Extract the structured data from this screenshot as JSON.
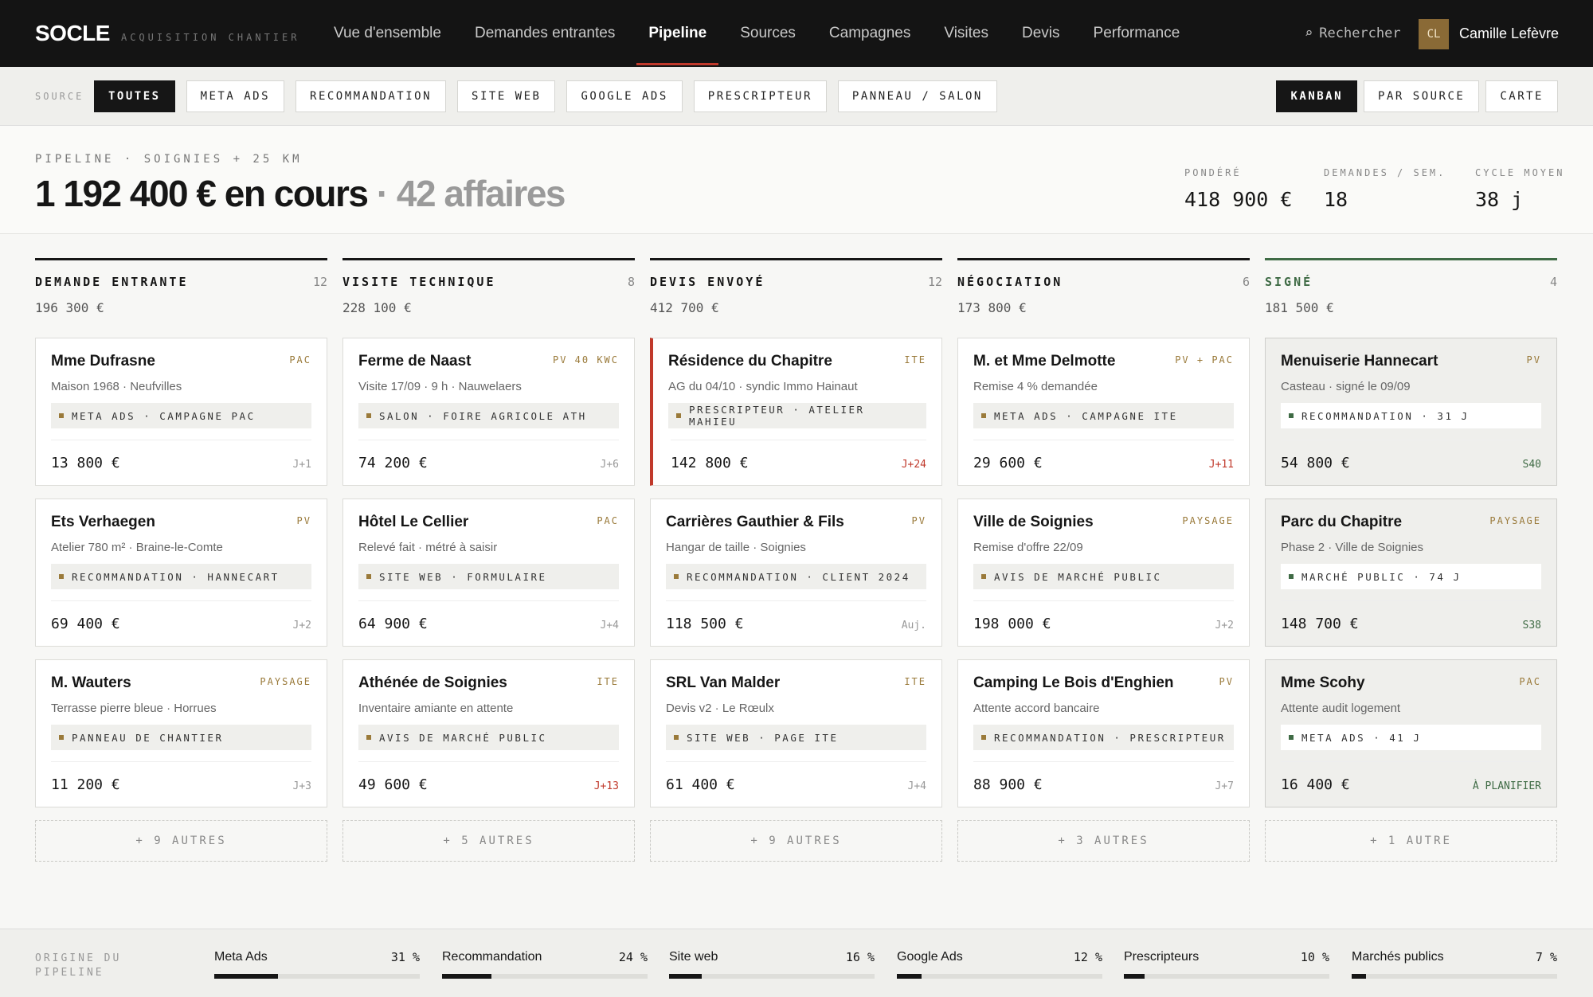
{
  "brand": {
    "name": "SOCLE",
    "subtitle": "ACQUISITION CHANTIER"
  },
  "nav": [
    {
      "label": "Vue d'ensemble"
    },
    {
      "label": "Demandes entrantes"
    },
    {
      "label": "Pipeline",
      "active": true
    },
    {
      "label": "Sources"
    },
    {
      "label": "Campagnes"
    },
    {
      "label": "Visites"
    },
    {
      "label": "Devis"
    },
    {
      "label": "Performance"
    }
  ],
  "search": {
    "label": "Rechercher",
    "icon": "search-icon"
  },
  "user": {
    "initials": "CL",
    "name": "Camille Lefèvre"
  },
  "filters": {
    "label": "SOURCE",
    "chips": [
      "TOUTES",
      "META ADS",
      "RECOMMANDATION",
      "SITE WEB",
      "GOOGLE ADS",
      "PRESCRIPTEUR",
      "PANNEAU / SALON"
    ],
    "active": "TOUTES"
  },
  "views": [
    "KANBAN",
    "PAR SOURCE",
    "CARTE"
  ],
  "summary": {
    "label": "PIPELINE · SOIGNIES + 25 KM",
    "total": "1 192 400 € en cours",
    "deals": " · 42 affaires",
    "stats": [
      {
        "label": "PONDÉRÉ",
        "value": "418 900 €"
      },
      {
        "label": "DEMANDES / SEM.",
        "value": "18"
      },
      {
        "label": "CYCLE MOYEN",
        "value": "38 j"
      }
    ]
  },
  "columns": [
    {
      "title": "DEMANDE ENTRANTE",
      "count": "12",
      "sum": "196 300 €",
      "more": "+ 9 AUTRES",
      "cards": [
        {
          "title": "Mme Dufrasne",
          "tag": "PAC",
          "sub": "Maison 1968 · Neufvilles",
          "source": "META ADS · CAMPAGNE PAC",
          "amount": "13 800 €",
          "age": "J+1"
        },
        {
          "title": "Ets Verhaegen",
          "tag": "PV",
          "sub": "Atelier 780 m² · Braine-le-Comte",
          "source": "RECOMMANDATION · HANNECART",
          "amount": "69 400 €",
          "age": "J+2"
        },
        {
          "title": "M. Wauters",
          "tag": "PAYSAGE",
          "sub": "Terrasse pierre bleue · Horrues",
          "source": "PANNEAU DE CHANTIER",
          "amount": "11 200 €",
          "age": "J+3"
        }
      ]
    },
    {
      "title": "VISITE TECHNIQUE",
      "count": "8",
      "sum": "228 100 €",
      "more": "+ 5 AUTRES",
      "cards": [
        {
          "title": "Ferme de Naast",
          "tag": "PV 40 KWC",
          "sub": "Visite 17/09 · 9 h · Nauwelaers",
          "source": "SALON · FOIRE AGRICOLE ATH",
          "amount": "74 200 €",
          "age": "J+6"
        },
        {
          "title": "Hôtel Le Cellier",
          "tag": "PAC",
          "sub": "Relevé fait · métré à saisir",
          "source": "SITE WEB · FORMULAIRE",
          "amount": "64 900 €",
          "age": "J+4"
        },
        {
          "title": "Athénée de Soignies",
          "tag": "ITE",
          "sub": "Inventaire amiante en attente",
          "source": "AVIS DE MARCHÉ PUBLIC",
          "amount": "49 600 €",
          "age": "J+13",
          "late": true
        }
      ]
    },
    {
      "title": "DEVIS ENVOYÉ",
      "count": "12",
      "sum": "412 700 €",
      "more": "+ 9 AUTRES",
      "cards": [
        {
          "title": "Résidence du Chapitre",
          "tag": "ITE",
          "sub": "AG du 04/10 · syndic Immo Hainaut",
          "source": "PRESCRIPTEUR · ATELIER MAHIEU",
          "amount": "142 800 €",
          "age": "J+24",
          "late": true,
          "alert": true
        },
        {
          "title": "Carrières Gauthier & Fils",
          "tag": "PV",
          "sub": "Hangar de taille · Soignies",
          "source": "RECOMMANDATION · CLIENT 2024",
          "amount": "118 500 €",
          "age": "Auj."
        },
        {
          "title": "SRL Van Malder",
          "tag": "ITE",
          "sub": "Devis v2 · Le Rœulx",
          "source": "SITE WEB · PAGE ITE",
          "amount": "61 400 €",
          "age": "J+4"
        }
      ]
    },
    {
      "title": "NÉGOCIATION",
      "count": "6",
      "sum": "173 800 €",
      "more": "+ 3 AUTRES",
      "cards": [
        {
          "title": "M. et Mme Delmotte",
          "tag": "PV + PAC",
          "sub": "Remise 4 % demandée",
          "source": "META ADS · CAMPAGNE ITE",
          "amount": "29 600 €",
          "age": "J+11",
          "late": true
        },
        {
          "title": "Ville de Soignies",
          "tag": "PAYSAGE",
          "sub": "Remise d'offre 22/09",
          "source": "AVIS DE MARCHÉ PUBLIC",
          "amount": "198 000 €",
          "age": "J+2"
        },
        {
          "title": "Camping Le Bois d'Enghien",
          "tag": "PV",
          "sub": "Attente accord bancaire",
          "source": "RECOMMANDATION · PRESCRIPTEUR",
          "amount": "88 900 €",
          "age": "J+7"
        }
      ]
    },
    {
      "title": "SIGNÉ",
      "count": "4",
      "sum": "181 500 €",
      "more": "+ 1 AUTRE",
      "signed": true,
      "cards": [
        {
          "title": "Menuiserie Hannecart",
          "tag": "PV",
          "sub": "Casteau · signé le 09/09",
          "source": "RECOMMANDATION · 31 J",
          "amount": "54 800 €",
          "age": "S40",
          "green": true
        },
        {
          "title": "Parc du Chapitre",
          "tag": "PAYSAGE",
          "sub": "Phase 2 · Ville de Soignies",
          "source": "MARCHÉ PUBLIC · 74 J",
          "amount": "148 700 €",
          "age": "S38",
          "green": true
        },
        {
          "title": "Mme Scohy",
          "tag": "PAC",
          "sub": "Attente audit logement",
          "source": "META ADS · 41 J",
          "amount": "16 400 €",
          "age": "À PLANIFIER",
          "green": true
        }
      ]
    }
  ],
  "origin": {
    "label": "ORIGINE DU PIPELINE",
    "items": [
      {
        "name": "Meta Ads",
        "pct": "31 %",
        "value": 31
      },
      {
        "name": "Recommandation",
        "pct": "24 %",
        "value": 24
      },
      {
        "name": "Site web",
        "pct": "16 %",
        "value": 16
      },
      {
        "name": "Google Ads",
        "pct": "12 %",
        "value": 12
      },
      {
        "name": "Prescripteurs",
        "pct": "10 %",
        "value": 10
      },
      {
        "name": "Marchés publics",
        "pct": "7 %",
        "value": 7
      }
    ]
  }
}
